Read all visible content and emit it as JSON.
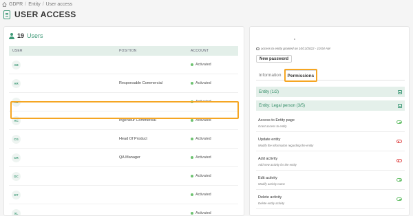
{
  "breadcrumb": {
    "items": [
      "GDPR",
      "Entity",
      "User access"
    ]
  },
  "page": {
    "title": "USER ACCESS"
  },
  "users": {
    "count": "19",
    "count_label": "Users",
    "columns": {
      "user": "USER",
      "position": "POSITION",
      "account": "ACCOUNT"
    },
    "rows": [
      {
        "initials": "AB",
        "position": "",
        "status": "Activated"
      },
      {
        "initials": "AR",
        "position": "Responsable Commercial",
        "status": "Activated"
      },
      {
        "initials": "AD",
        "position": "",
        "status": "Activated"
      },
      {
        "initials": "AC",
        "position": "Ingénieur Commercial",
        "status": "Activated"
      },
      {
        "initials": "CG",
        "position": "Head Of Product",
        "status": "Activated"
      },
      {
        "initials": "CR",
        "position": "QA Manager",
        "status": "Activated"
      },
      {
        "initials": "DC",
        "position": "",
        "status": "Activated"
      },
      {
        "initials": "DT",
        "position": "",
        "status": "Activated"
      },
      {
        "initials": "XL",
        "position": "",
        "status": "Activated"
      }
    ]
  },
  "details": {
    "access_text": "access to entity granted on 10/13/2022 - 10:04 AM",
    "new_password_label": "New password",
    "tabs": [
      "Information",
      "Permissions"
    ],
    "active_tab": "Permissions",
    "sections": [
      "Entity (1/2)",
      "Entity: Legal person (3/5)"
    ],
    "permissions": [
      {
        "title": "Access to Entity page",
        "desc": "Grant access to entity",
        "enabled": true
      },
      {
        "title": "Update entity",
        "desc": "Modify the information regarding the entity",
        "enabled": false
      },
      {
        "title": "Add activity",
        "desc": "Add new activity for the entity",
        "enabled": false
      },
      {
        "title": "Edit activity",
        "desc": "Modify activity name",
        "enabled": true
      },
      {
        "title": "Delete activity",
        "desc": "Delete entity activity",
        "enabled": true
      }
    ]
  },
  "colors": {
    "accent": "#3f9a78",
    "highlight": "#f5a623",
    "active_dot": "#6cc26f",
    "toggle_off": "#e05252"
  }
}
